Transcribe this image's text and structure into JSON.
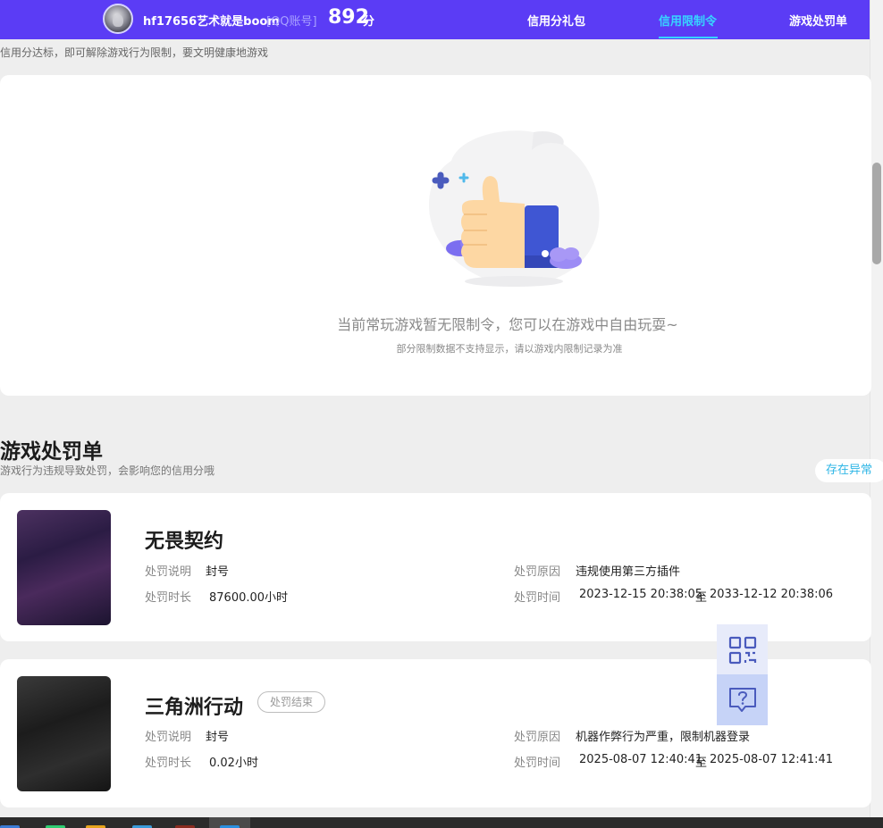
{
  "topbar": {
    "username": "hf17656艺术就是boom",
    "account_type": "[QQ账号]",
    "score": "892",
    "score_unit": "分",
    "nav": [
      {
        "label": "信用分礼包",
        "active": false
      },
      {
        "label": "信用限制令",
        "active": true
      },
      {
        "label": "游戏处罚单",
        "active": false
      }
    ]
  },
  "restriction": {
    "hint": "信用分达标，即可解除游戏行为限制，要文明健康地游戏",
    "empty_title": "当前常玩游戏暂无限制令，您可以在游戏中自由玩耍~",
    "empty_sub": "部分限制数据不支持显示，请以游戏内限制记录为准"
  },
  "penalties": {
    "title": "游戏处罚单",
    "subtitle": "游戏行为违规导致处罚，会影响您的信用分哦",
    "report_button": "存在异常",
    "labels": {
      "desc": "处罚说明",
      "duration": "处罚时长",
      "reason": "处罚原因",
      "time": "处罚时间",
      "to": "至"
    },
    "items": [
      {
        "game": "无畏契约",
        "status": "",
        "desc": "封号",
        "duration": "87600.00小时",
        "reason": "违规使用第三方插件",
        "start": "2023-12-15 20:38:05",
        "end": "2033-12-12 20:38:06"
      },
      {
        "game": "三角洲行动",
        "status": "处罚结束",
        "desc": "封号",
        "duration": "0.02小时",
        "reason": "机器作弊行为严重，限制机器登录",
        "start": "2025-08-07 12:40:41",
        "end": "2025-08-07 12:41:41"
      }
    ]
  },
  "widgets": {
    "qr_icon": "qr-code-icon",
    "help_icon": "help-chat-icon"
  },
  "colors": {
    "brand": "#5b3cf5",
    "active_nav": "#37d5ff",
    "report_link": "#2fb6e6"
  }
}
